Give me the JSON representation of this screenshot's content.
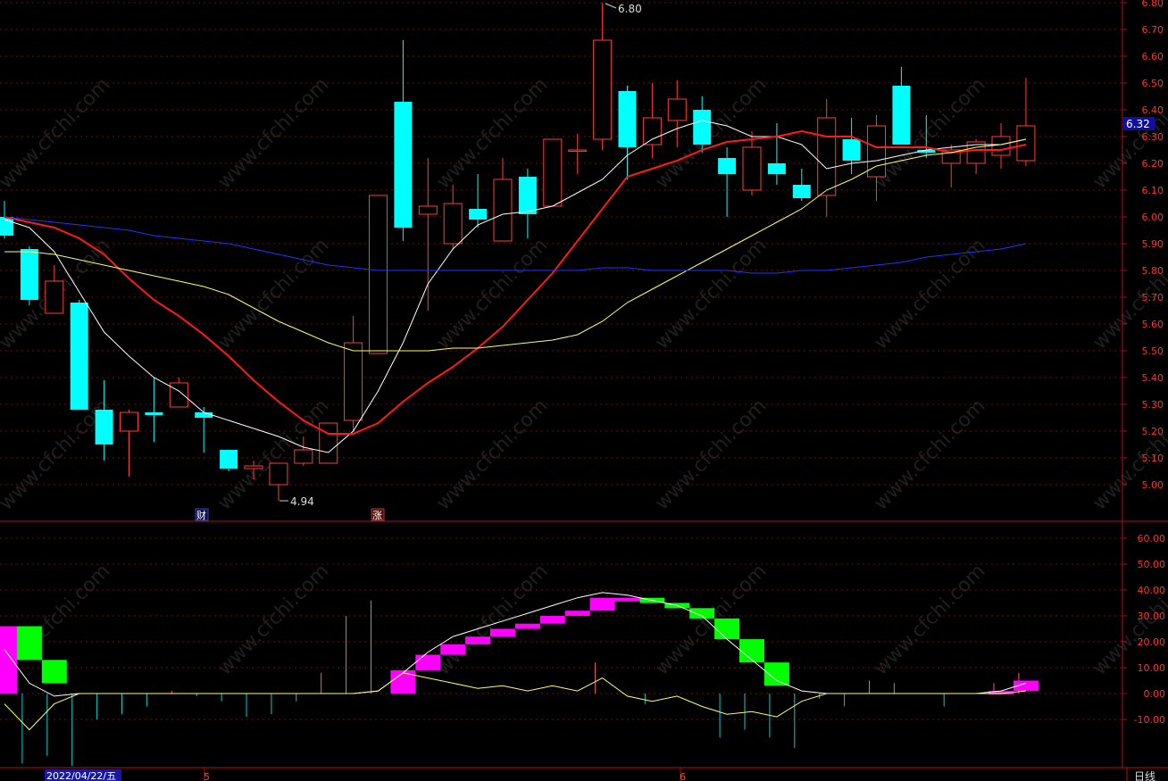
{
  "watermark": "www.cfchi.com",
  "colors": {
    "background": "#000000",
    "up": "#ff3b3b",
    "down": "#00ffff",
    "axis": "#b01010",
    "grid": "#7a0a0a",
    "ma_white": "#ffffff",
    "ma_red": "#ff1a1a",
    "ma_yellow": "#ffff66",
    "ma_blue": "#2233ff",
    "hist_pos": "#ff00ff",
    "hist_neg": "#00ff00",
    "vol_pos": "#ff6060",
    "vol_neg": "#00d0d0",
    "last_price_box": "#1010a0"
  },
  "date_labels": {
    "start": "2022/04/22/五",
    "may": "5",
    "june": "6"
  },
  "period_label": "日线",
  "last_price": "6.32",
  "event_markers": [
    "财",
    "涨"
  ],
  "price_annotations": {
    "high": "6.80",
    "low": "4.94"
  },
  "chart_data": [
    {
      "type": "candlestick",
      "ylim": [
        4.88,
        6.8
      ],
      "yticks": [
        "6.80",
        "6.70",
        "6.60",
        "6.50",
        "6.40",
        "6.30",
        "6.20",
        "6.10",
        "6.00",
        "5.90",
        "5.80",
        "5.70",
        "5.60",
        "5.50",
        "5.40",
        "5.30",
        "5.20",
        "5.10",
        "5.00"
      ],
      "grid": true,
      "candles": [
        {
          "o": 6.0,
          "h": 6.06,
          "l": 5.92,
          "c": 5.93
        },
        {
          "o": 5.88,
          "h": 5.89,
          "l": 5.67,
          "c": 5.69
        },
        {
          "o": 5.64,
          "h": 5.82,
          "l": 5.64,
          "c": 5.76
        },
        {
          "o": 5.68,
          "h": 5.69,
          "l": 5.28,
          "c": 5.28
        },
        {
          "o": 5.28,
          "h": 5.39,
          "l": 5.09,
          "c": 5.15
        },
        {
          "o": 5.2,
          "h": 5.28,
          "l": 5.03,
          "c": 5.27
        },
        {
          "o": 5.27,
          "h": 5.4,
          "l": 5.16,
          "c": 5.26
        },
        {
          "o": 5.29,
          "h": 5.4,
          "l": 5.29,
          "c": 5.38
        },
        {
          "o": 5.27,
          "h": 5.29,
          "l": 5.12,
          "c": 5.25
        },
        {
          "o": 5.13,
          "h": 5.13,
          "l": 5.05,
          "c": 5.06
        },
        {
          "o": 5.06,
          "h": 5.09,
          "l": 5.02,
          "c": 5.07
        },
        {
          "o": 5.0,
          "h": 5.08,
          "l": 4.94,
          "c": 5.08
        },
        {
          "o": 5.08,
          "h": 5.18,
          "l": 5.07,
          "c": 5.13
        },
        {
          "o": 5.08,
          "h": 5.23,
          "l": 5.08,
          "c": 5.23
        },
        {
          "o": 5.24,
          "h": 5.63,
          "l": 5.2,
          "c": 5.53
        },
        {
          "o": 5.49,
          "h": 6.08,
          "l": 5.49,
          "c": 6.08
        },
        {
          "o": 6.43,
          "h": 6.66,
          "l": 5.91,
          "c": 5.96
        },
        {
          "o": 6.01,
          "h": 6.22,
          "l": 5.65,
          "c": 6.04
        },
        {
          "o": 5.9,
          "h": 6.12,
          "l": 5.88,
          "c": 6.05
        },
        {
          "o": 6.03,
          "h": 6.16,
          "l": 5.96,
          "c": 5.99
        },
        {
          "o": 5.91,
          "h": 6.22,
          "l": 5.91,
          "c": 6.14
        },
        {
          "o": 6.15,
          "h": 6.18,
          "l": 5.92,
          "c": 6.01
        },
        {
          "o": 6.04,
          "h": 6.29,
          "l": 6.04,
          "c": 6.29
        },
        {
          "o": 6.25,
          "h": 6.31,
          "l": 6.16,
          "c": 6.25
        },
        {
          "o": 6.29,
          "h": 6.8,
          "l": 6.25,
          "c": 6.66
        },
        {
          "o": 6.47,
          "h": 6.49,
          "l": 6.14,
          "c": 6.26
        },
        {
          "o": 6.27,
          "h": 6.5,
          "l": 6.22,
          "c": 6.37
        },
        {
          "o": 6.36,
          "h": 6.51,
          "l": 6.26,
          "c": 6.44
        },
        {
          "o": 6.4,
          "h": 6.45,
          "l": 6.24,
          "c": 6.27
        },
        {
          "o": 6.22,
          "h": 6.26,
          "l": 6.0,
          "c": 6.16
        },
        {
          "o": 6.1,
          "h": 6.32,
          "l": 6.08,
          "c": 6.26
        },
        {
          "o": 6.2,
          "h": 6.35,
          "l": 6.12,
          "c": 6.16
        },
        {
          "o": 6.12,
          "h": 6.18,
          "l": 6.06,
          "c": 6.07
        },
        {
          "o": 6.08,
          "h": 6.44,
          "l": 6.0,
          "c": 6.37
        },
        {
          "o": 6.29,
          "h": 6.37,
          "l": 6.16,
          "c": 6.21
        },
        {
          "o": 6.15,
          "h": 6.38,
          "l": 6.06,
          "c": 6.34
        },
        {
          "o": 6.49,
          "h": 6.56,
          "l": 6.27,
          "c": 6.27
        },
        {
          "o": 6.25,
          "h": 6.38,
          "l": 6.22,
          "c": 6.24
        },
        {
          "o": 6.2,
          "h": 6.27,
          "l": 6.11,
          "c": 6.25
        },
        {
          "o": 6.2,
          "h": 6.29,
          "l": 6.16,
          "c": 6.28
        },
        {
          "o": 6.23,
          "h": 6.35,
          "l": 6.18,
          "c": 6.3
        },
        {
          "o": 6.21,
          "h": 6.52,
          "l": 6.19,
          "c": 6.34
        }
      ],
      "series": [
        {
          "color": "ma_white",
          "values": [
            5.99,
            5.96,
            5.87,
            5.72,
            5.57,
            5.48,
            5.4,
            5.35,
            5.27,
            5.24,
            5.21,
            5.18,
            5.14,
            5.12,
            5.2,
            5.35,
            5.53,
            5.75,
            5.88,
            5.97,
            6.01,
            6.02,
            6.04,
            6.09,
            6.14,
            6.23,
            6.29,
            6.33,
            6.36,
            6.34,
            6.3,
            6.3,
            6.27,
            6.18,
            6.2,
            6.21,
            6.23,
            6.25,
            6.26,
            6.27,
            6.27,
            6.29
          ]
        },
        {
          "color": "ma_red",
          "values": [
            6.0,
            5.98,
            5.96,
            5.92,
            5.86,
            5.77,
            5.69,
            5.63,
            5.56,
            5.48,
            5.39,
            5.31,
            5.24,
            5.19,
            5.19,
            5.23,
            5.31,
            5.38,
            5.44,
            5.51,
            5.59,
            5.69,
            5.79,
            5.91,
            6.03,
            6.15,
            6.18,
            6.21,
            6.25,
            6.28,
            6.29,
            6.3,
            6.32,
            6.3,
            6.3,
            6.26,
            6.26,
            6.26,
            6.24,
            6.25,
            6.25,
            6.27
          ]
        },
        {
          "color": "ma_yellow",
          "values": [
            5.87,
            5.87,
            5.86,
            5.84,
            5.82,
            5.8,
            5.78,
            5.76,
            5.74,
            5.71,
            5.66,
            5.61,
            5.57,
            5.53,
            5.5,
            5.5,
            5.5,
            5.5,
            5.51,
            5.51,
            5.52,
            5.53,
            5.54,
            5.56,
            5.61,
            5.68,
            5.73,
            5.78,
            5.83,
            5.88,
            5.93,
            5.98,
            6.03,
            6.1,
            6.14,
            6.19,
            6.21,
            6.23,
            6.24,
            6.26,
            6.27,
            6.29
          ]
        },
        {
          "color": "ma_blue",
          "values": [
            6.0,
            5.99,
            5.98,
            5.97,
            5.96,
            5.95,
            5.93,
            5.92,
            5.91,
            5.9,
            5.88,
            5.86,
            5.84,
            5.82,
            5.81,
            5.8,
            5.8,
            5.8,
            5.8,
            5.8,
            5.8,
            5.8,
            5.8,
            5.8,
            5.81,
            5.81,
            5.8,
            5.8,
            5.8,
            5.8,
            5.79,
            5.79,
            5.8,
            5.8,
            5.81,
            5.82,
            5.83,
            5.85,
            5.86,
            5.87,
            5.88,
            5.9
          ]
        }
      ]
    },
    {
      "type": "bar",
      "ylim": [
        -28,
        66
      ],
      "yticks": [
        "60.00",
        "50.00",
        "40.00",
        "30.00",
        "20.00",
        "10.00",
        "0.00",
        "-10.00"
      ],
      "grid": true,
      "histogram": [
        26,
        13,
        4,
        0,
        0,
        0,
        0,
        0,
        0,
        0,
        0,
        0,
        0,
        0,
        0,
        0,
        9,
        15,
        19,
        22,
        25,
        27,
        30,
        32,
        37,
        37,
        35,
        33,
        29,
        21,
        12,
        3,
        0,
        0,
        0,
        0,
        0,
        0,
        0,
        0,
        1,
        5
      ],
      "lines": [
        {
          "color": "ma_white",
          "values": [
            17,
            4,
            -1,
            0,
            0,
            0,
            0,
            0,
            0,
            0,
            0,
            0,
            0,
            0,
            0,
            1,
            8,
            16,
            22,
            25,
            28,
            31,
            34,
            37,
            39,
            38,
            36,
            34,
            30,
            21,
            13,
            5,
            1,
            0,
            0,
            0,
            0,
            0,
            0,
            0,
            1,
            4
          ]
        },
        {
          "color": "ma_yellow",
          "values": [
            -4,
            -14,
            -4,
            0,
            0,
            0,
            0,
            0,
            0,
            0,
            0,
            0,
            0,
            0,
            0,
            1,
            8,
            6,
            4,
            2,
            3,
            1,
            3,
            1,
            6,
            -1,
            -3,
            -1,
            -5,
            -8,
            -7,
            -9,
            -3,
            0,
            0,
            0,
            0,
            0,
            0,
            0,
            0,
            1
          ]
        }
      ],
      "volume_lines": [
        -8,
        -27,
        -24,
        -28,
        -10,
        -8,
        -5,
        1,
        -1,
        -3,
        -9,
        -8,
        -3,
        8,
        30,
        36,
        0,
        0,
        0,
        0,
        0,
        0,
        0,
        0,
        12,
        0,
        -4,
        0,
        0,
        -17,
        -14,
        -17,
        -21,
        -2,
        -5,
        5,
        4,
        0,
        -5,
        0,
        4,
        8
      ]
    }
  ]
}
